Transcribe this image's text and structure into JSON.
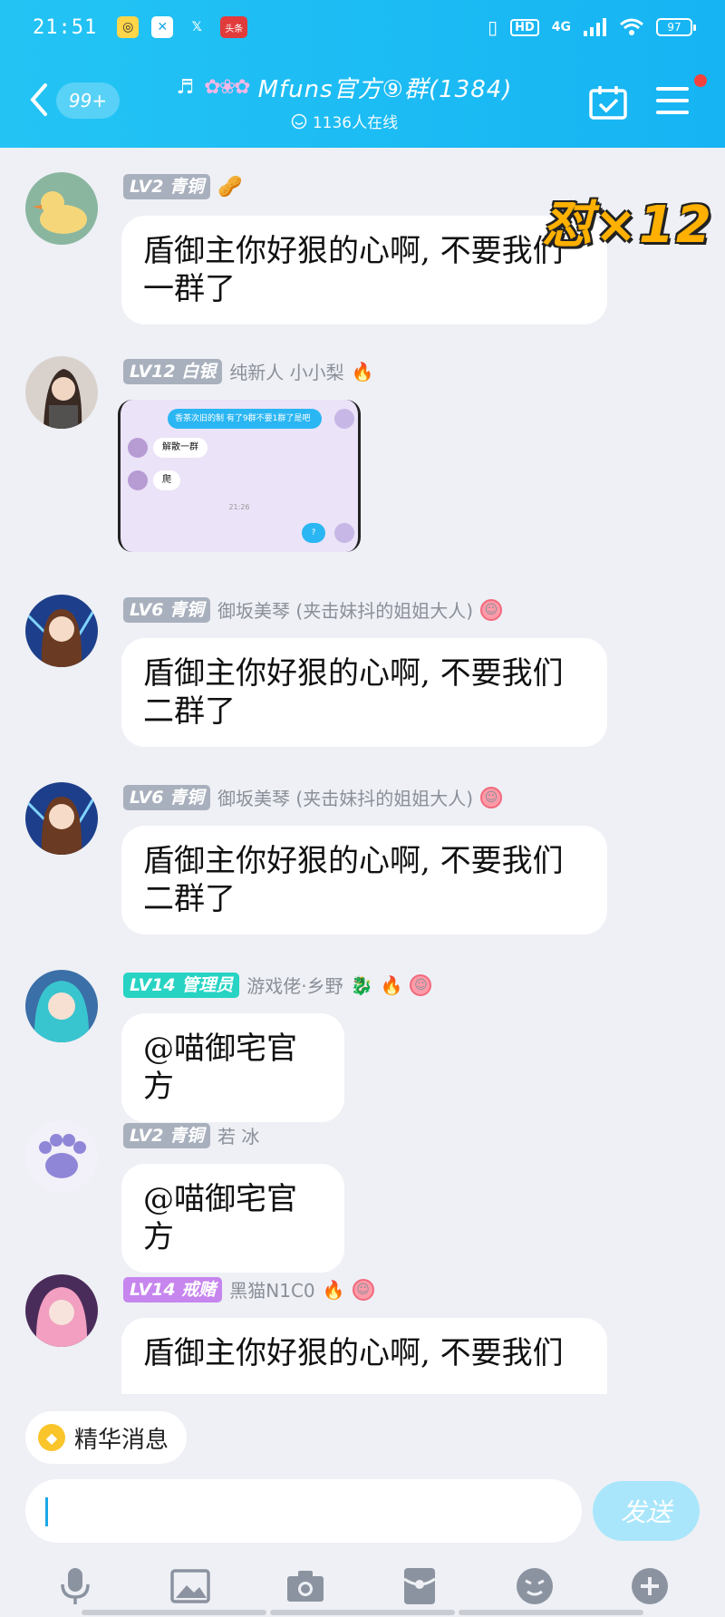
{
  "status_bar": {
    "time": "21:51",
    "network": "4G",
    "hd": "HD",
    "battery": "97",
    "app_badge": "头条"
  },
  "header": {
    "unread_count": "99+",
    "group_title": "Mfuns官方⑨群(1384)",
    "online": "1136人在线"
  },
  "combo": "怼×12",
  "messages": [
    {
      "badge": "LV2 青铜",
      "badge_style": "gray",
      "name": "",
      "text_lines": [
        "盾御主你好狠的心啊, 不要我们",
        "一群了"
      ]
    },
    {
      "badge": "LV12 白银",
      "badge_style": "gray",
      "name": "纯新人  小小梨",
      "image": {
        "quote": "香茶次旧的制  有了9群不要1群了是吧",
        "line1": "解散一群",
        "line2": "爬",
        "time": "21:26",
        "reply": "?"
      }
    },
    {
      "badge": "LV6 青铜",
      "badge_style": "gray",
      "name": "御坂美琴 (夹击妹抖的姐姐大人)",
      "text_lines": [
        "盾御主你好狠的心啊, 不要我们",
        "二群了"
      ]
    },
    {
      "badge": "LV6 青铜",
      "badge_style": "gray",
      "name": "御坂美琴 (夹击妹抖的姐姐大人)",
      "text_lines": [
        "盾御主你好狠的心啊, 不要我们",
        "二群了"
      ]
    },
    {
      "badge": "LV14 管理员",
      "badge_style": "admin",
      "name": "游戏佬·乡野",
      "text_lines": [
        "@喵御宅官方"
      ]
    },
    {
      "badge": "LV2 青铜",
      "badge_style": "gray",
      "name": "若 冰",
      "text_lines": [
        "@喵御宅官方"
      ]
    },
    {
      "badge": "LV14 戒赌",
      "badge_style": "purple",
      "name": "黑猫N1C0",
      "text_lines": [
        "盾御主你好狠的心啊, 不要我们"
      ]
    }
  ],
  "essence_label": "精华消息",
  "input": {
    "value": ""
  },
  "send_label": "发送",
  "colors": {
    "accent": "#1cbdf4",
    "send_disabled": "#a9e6fb",
    "admin_badge": "#27d3c3",
    "purple_badge": "#c785ee",
    "gray_badge": "#a9b0bd"
  },
  "toolbar_icons": [
    "microphone-icon",
    "image-icon",
    "camera-icon",
    "red-packet-icon",
    "emoji-icon",
    "plus-icon"
  ]
}
